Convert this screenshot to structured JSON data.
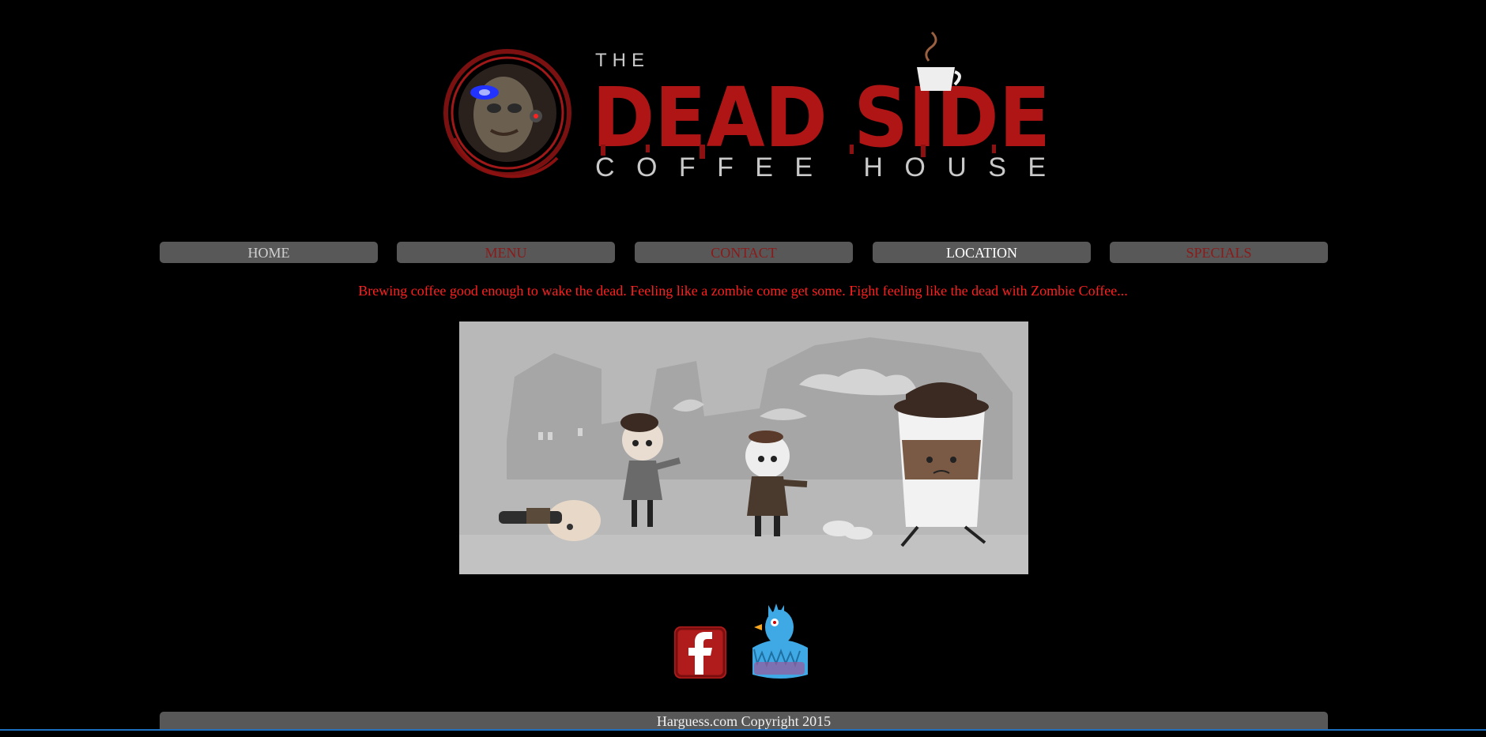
{
  "brand": {
    "logo_top": "THE",
    "logo_main": "DEAD SIDE",
    "logo_sub": "COFFEE HOUSE",
    "accent_color": "#b01515"
  },
  "nav": {
    "items": [
      {
        "label": "HOME",
        "state": "default"
      },
      {
        "label": "MENU",
        "state": "default"
      },
      {
        "label": "CONTACT",
        "state": "default"
      },
      {
        "label": "LOCATION",
        "state": "active"
      },
      {
        "label": "SPECIALS",
        "state": "default"
      }
    ]
  },
  "tagline": "Brewing coffee good enough to wake the dead. Feeling like a zombie come get some. Fight feeling like the dead with Zombie Coffee...",
  "illustration": {
    "icon": "zombies-chasing-coffee-illustration"
  },
  "social": {
    "facebook_icon": "facebook-icon",
    "twitter_icon": "twitter-zombie-bird-icon"
  },
  "footer": {
    "copyright": "Harguess.com Copyright 2015"
  }
}
